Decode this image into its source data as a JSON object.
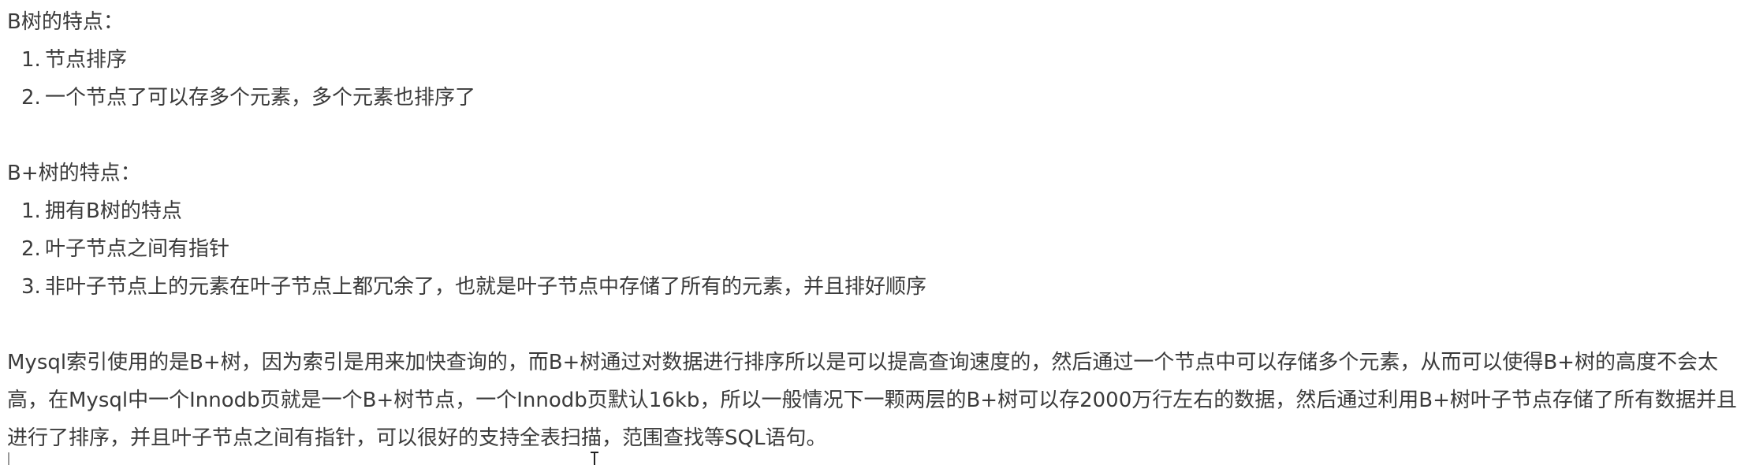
{
  "btree": {
    "heading": "B树的特点：",
    "items": [
      {
        "num": "1.",
        "text": "节点排序"
      },
      {
        "num": "2.",
        "text": "一个节点了可以存多个元素，多个元素也排序了"
      }
    ]
  },
  "bplustree": {
    "heading": "B+树的特点：",
    "items": [
      {
        "num": "1.",
        "text": "拥有B树的特点"
      },
      {
        "num": "2.",
        "text": "叶子节点之间有指针"
      },
      {
        "num": "3.",
        "text": "非叶子节点上的元素在叶子节点上都冗余了，也就是叶子节点中存储了所有的元素，并且排好顺序"
      }
    ]
  },
  "summary": {
    "paragraph": "Mysql索引使用的是B+树，因为索引是用来加快查询的，而B+树通过对数据进行排序所以是可以提高查询速度的，然后通过一个节点中可以存储多个元素，从而可以使得B+树的高度不会太高，在Mysql中一个Innodb页就是一个B+树节点，一个Innodb页默认16kb，所以一般情况下一颗两层的B+树可以存2000万行左右的数据，然后通过利用B+树叶子节点存储了所有数据并且进行了排序，并且叶子节点之间有指针，可以很好的支持全表扫描，范围查找等SQL语句。"
  }
}
